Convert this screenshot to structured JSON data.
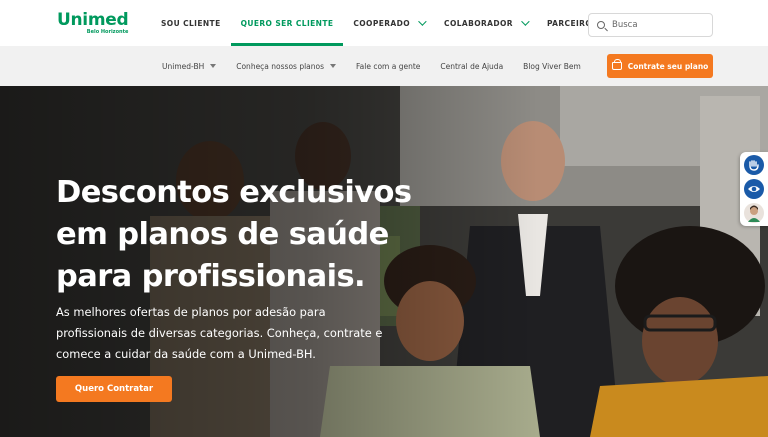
{
  "brand": {
    "name": "Unimed",
    "region": "Belo Horizonte",
    "color": "#00995D",
    "accent": "#F47920"
  },
  "main_nav": {
    "items": [
      {
        "label": "SOU CLIENTE",
        "has_dropdown": false,
        "active": false
      },
      {
        "label": "QUERO SER CLIENTE",
        "has_dropdown": false,
        "active": true
      },
      {
        "label": "COOPERADO",
        "has_dropdown": true,
        "active": false
      },
      {
        "label": "COLABORADOR",
        "has_dropdown": true,
        "active": false
      },
      {
        "label": "PARCEIROS",
        "has_dropdown": true,
        "active": false
      }
    ]
  },
  "search": {
    "placeholder": "Busca",
    "icon": "search-icon"
  },
  "sub_nav": {
    "items": [
      {
        "label": "Unimed-BH",
        "has_dropdown": true
      },
      {
        "label": "Conheça nossos planos",
        "has_dropdown": true
      },
      {
        "label": "Fale com a gente",
        "has_dropdown": false
      },
      {
        "label": "Central de Ajuda",
        "has_dropdown": false
      },
      {
        "label": "Blog Viver Bem",
        "has_dropdown": false
      }
    ],
    "cta_label": "Contrate seu plano",
    "cta_icon": "shopping-cart-icon"
  },
  "hero": {
    "title_lines": [
      "Descontos exclusivos",
      "em planos de saúde",
      "para profissionais."
    ],
    "description_lines": [
      "As melhores ofertas de planos por adesão para",
      "profissionais de diversas categorias. Conheça, contrate e",
      "comece a cuidar da saúde com a Unimed-BH."
    ],
    "cta_label": "Quero Contratar"
  },
  "accessibility": {
    "buttons": [
      "sign-language-hand-icon",
      "eye-icon",
      "assistant-avatar-icon"
    ]
  }
}
